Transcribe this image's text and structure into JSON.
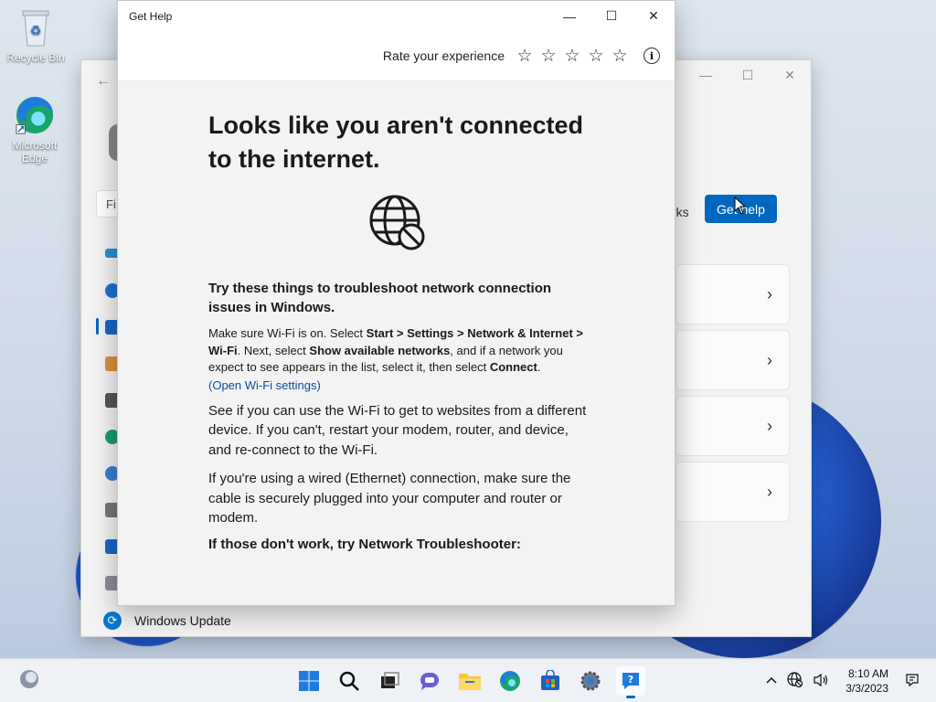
{
  "desktop": {
    "icons": [
      {
        "label": "Recycle Bin"
      },
      {
        "label": "Microsoft Edge"
      }
    ]
  },
  "settings_window": {
    "search_placeholder": "Fi",
    "partial_text": "rks",
    "get_help_button": "Get help",
    "nav_last_item": "Windows Update"
  },
  "get_help": {
    "title": "Get Help",
    "rate_label": "Rate your experience",
    "heading": "Looks like you aren't connected to the internet.",
    "subheading": "Try these things to troubleshoot network connection issues in Windows.",
    "para1": {
      "t1": "Make sure Wi-Fi is on. Select ",
      "b1": "Start",
      "s1": " > ",
      "b2": "Settings",
      "s2": " > ",
      "b3": "Network & Internet",
      "s3": " > ",
      "b4": "Wi-Fi",
      "t2": ". Next, select ",
      "b5": "Show available networks",
      "t3": ", and if a network you expect to see appears in the list, select it, then select ",
      "b6": "Connect",
      "t4": "."
    },
    "link": "(Open Wi-Fi settings)",
    "para2": "See if you can use the Wi-Fi to get to websites from a different device. If you can't, restart your modem, router, and device, and re-connect to the Wi-Fi.",
    "para3": "If you're using a wired (Ethernet) connection, make sure the cable is securely plugged into your computer and router or modem.",
    "para4": "If those don't work, try Network Troubleshooter:"
  },
  "taskbar": {
    "time": "8:10 AM",
    "date": "3/3/2023"
  },
  "colors": {
    "accent": "#0067c0",
    "link": "#0a4ea1"
  }
}
